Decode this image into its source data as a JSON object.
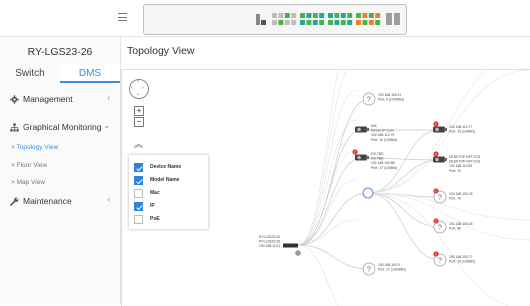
{
  "topbar": {
    "menu_icon": "hamburger-icon",
    "port_colors": {
      "off": "#bdbdbd",
      "linked": "#4caf50",
      "poe": "#26a69a",
      "warn": "#ef7d2c",
      "uplink": "#9e9e9e"
    }
  },
  "sidebar": {
    "device_title": "RY-LGS23-26",
    "tabs": [
      {
        "label": "Switch",
        "active": false
      },
      {
        "label": "DMS",
        "active": true
      }
    ],
    "menu": [
      {
        "label": "Management",
        "icon": "gear-icon",
        "chevron": "‹"
      },
      {
        "label": "Graphical Monitoring",
        "icon": "sitemap-icon",
        "chevron": "⌄"
      },
      {
        "label": "Maintenance",
        "icon": "wrench-icon",
        "chevron": "‹"
      }
    ],
    "submenu": [
      {
        "label": "> Topology View",
        "active": true
      },
      {
        "label": "> Floor View",
        "active": false
      },
      {
        "label": "> Map View",
        "active": false
      }
    ]
  },
  "main": {
    "title": "Topology View",
    "controls": {
      "pan_icon": "pan-arrows-icon",
      "zoom_in": "+",
      "zoom_out": "−",
      "collapse_icon": "double-chevron-up-icon"
    },
    "legend": [
      {
        "label": "Device Name",
        "checked": true
      },
      {
        "label": "Model Name",
        "checked": true
      },
      {
        "label": "Mac",
        "checked": false
      },
      {
        "label": "IP",
        "checked": true
      },
      {
        "label": "PoE",
        "checked": false
      }
    ],
    "root_node": {
      "lines": [
        "RY-LGS23-26",
        "RY-LGS23-26",
        "192.168.110.1"
      ]
    },
    "nodes": [
      {
        "type": "unknown",
        "lines": [
          "192.168.100.11",
          "Port: 9 (1000M/s)"
        ],
        "badge": false
      },
      {
        "type": "camera",
        "lines": [
          "N/A",
          "Device IP Cam",
          "192.168.110.79",
          "Port: 1b (100M/s)"
        ],
        "badge": false
      },
      {
        "type": "camera",
        "lines": [
          "DS-TBD",
          "DS-TBD",
          "192.168.100.86",
          "Port: 17 (100M/s)"
        ],
        "badge": true
      },
      {
        "type": "hub",
        "lines": [],
        "badge": false
      },
      {
        "type": "unknown",
        "lines": [
          "192.168.100.9",
          "Port: 21 (1000M/s)"
        ],
        "badge": false
      }
    ],
    "leaf_nodes": [
      {
        "type": "camera",
        "lines": [
          "192.168.110.77",
          "Port: 19 (100M/s)"
        ],
        "badge": true
      },
      {
        "type": "camera",
        "lines": [
          "DESKTOP-NFTCGS",
          "DESKTOP-NFTCGS",
          "192.168.110.69",
          "Port: 7b"
        ],
        "badge": true
      },
      {
        "type": "unknown",
        "lines": [
          "192.168.100.25",
          "Port: 7b"
        ],
        "badge": true
      },
      {
        "type": "unknown",
        "lines": [
          "192.168.100.45",
          "Port: 9b"
        ],
        "badge": true
      },
      {
        "type": "unknown",
        "lines": [
          "192.168.100.77",
          "Port: 19 (100M/s)"
        ],
        "badge": true
      }
    ],
    "colors": {
      "link": "#c9c9c9",
      "hub": "#5b8fd6",
      "alert": "#e53935",
      "accent": "#3a8dde"
    }
  }
}
